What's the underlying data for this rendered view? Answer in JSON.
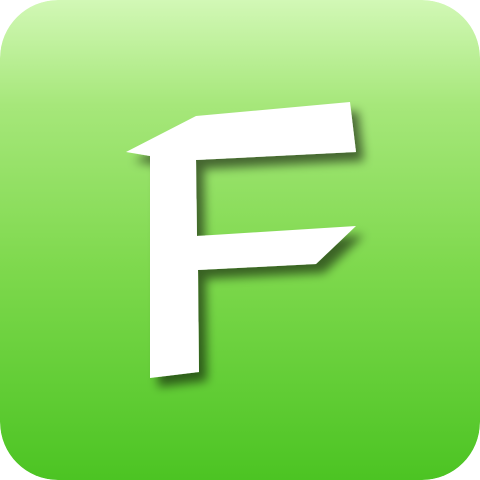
{
  "app_icon": {
    "logo_letter": "F",
    "icon_name": "f-letter-logo-icon",
    "colors": {
      "gradient_top": "#d2f8b6",
      "gradient_upper": "#a6e77a",
      "gradient_mid": "#7fd94e",
      "gradient_bottom": "#4cc423",
      "glyph": "#ffffff",
      "glyph_shadow": "#1d4d0a"
    }
  }
}
